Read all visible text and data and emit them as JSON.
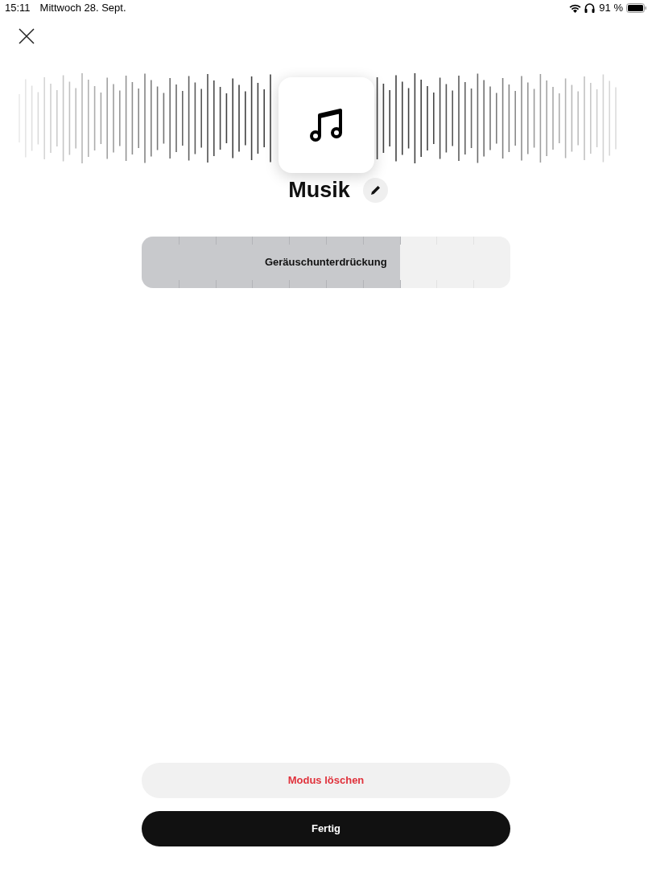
{
  "status_bar": {
    "time": "15:11",
    "date": "Mittwoch 28. Sept.",
    "battery": "91 %"
  },
  "mode": {
    "name": "Musik"
  },
  "slider": {
    "label": "Geräuschunterdrückung",
    "level": 0.7
  },
  "buttons": [
    {
      "label": "Modus löschen",
      "kind": "destructive"
    },
    {
      "label": "Fertig",
      "kind": "primary"
    }
  ]
}
